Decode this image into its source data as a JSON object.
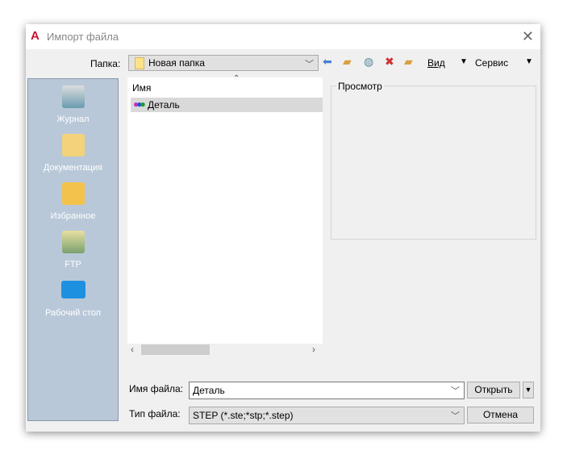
{
  "window": {
    "title": "Импорт файла",
    "app_icon": "autocad-icon"
  },
  "folder": {
    "label": "Папка:",
    "value": "Новая папка"
  },
  "toolbar": {
    "view_label": "Вид",
    "service_label": "Сервис"
  },
  "sidebar": {
    "items": [
      {
        "label": "Журнал",
        "icon": "history-icon"
      },
      {
        "label": "Документация",
        "icon": "documents-icon"
      },
      {
        "label": "Избранное",
        "icon": "favorites-icon"
      },
      {
        "label": "FTP",
        "icon": "ftp-icon"
      },
      {
        "label": "Рабочий стол",
        "icon": "desktop-icon"
      }
    ]
  },
  "file_list": {
    "column_name": "Имя",
    "items": [
      {
        "name": "Деталь",
        "selected": true
      }
    ]
  },
  "preview": {
    "label": "Просмотр"
  },
  "filename": {
    "label": "Имя файла:",
    "value": "Деталь"
  },
  "filetype": {
    "label": "Тип файла:",
    "value": "STEP (*.ste;*stp;*.step)"
  },
  "buttons": {
    "open": "Открыть",
    "cancel": "Отмена"
  }
}
